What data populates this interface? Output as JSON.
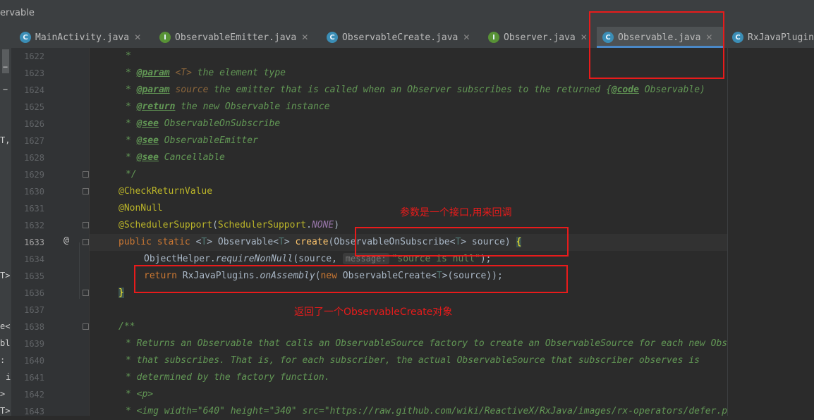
{
  "window": {
    "title": "ervable"
  },
  "tabs": [
    {
      "label": "MainActivity.java",
      "icon": "c",
      "active": false,
      "close": "✕"
    },
    {
      "label": "ObservableEmitter.java",
      "icon": "i",
      "active": false,
      "close": "✕"
    },
    {
      "label": "ObservableCreate.java",
      "icon": "c",
      "active": false,
      "close": "✕"
    },
    {
      "label": "Observer.java",
      "icon": "i",
      "active": false,
      "close": "✕"
    },
    {
      "label": "Observable.java",
      "icon": "c",
      "active": true,
      "close": "✕"
    },
    {
      "label": "RxJavaPlugins",
      "icon": "c",
      "active": false,
      "close": ""
    }
  ],
  "left_strip": {
    "fragments": [
      "T,",
      "T>",
      "e<",
      "bl",
      ":",
      "i",
      ">",
      "T>"
    ]
  },
  "gutter": {
    "line_numbers": [
      "1622",
      "1623",
      "1624",
      "1625",
      "1626",
      "1627",
      "1628",
      "1629",
      "1630",
      "1631",
      "1632",
      "1633",
      "1634",
      "1635",
      "1636",
      "1637",
      "1638",
      "1639",
      "1640",
      "1641",
      "1642",
      "1643"
    ],
    "current_line": "1633",
    "override_mark": "@"
  },
  "code": {
    "l1622": "*",
    "l1623": {
      "star": "* ",
      "tag": "@param",
      "param": "<T>",
      "rest": " the element type"
    },
    "l1624": {
      "star": "* ",
      "tag": "@param",
      "param": "source",
      "rest": " the emitter that is called when an Observer subscribes to the returned {",
      "code": "@code",
      "tail": " Observable)"
    },
    "l1625": {
      "star": "* ",
      "tag": "@return",
      "rest": " the new Observable instance"
    },
    "l1626": {
      "star": "* ",
      "tag": "@see",
      "rest": " ObservableOnSubscribe"
    },
    "l1627": {
      "star": "* ",
      "tag": "@see",
      "rest": " ObservableEmitter"
    },
    "l1628": {
      "star": "* ",
      "tag": "@see",
      "rest": " Cancellable"
    },
    "l1629": "*/",
    "l1630": "@CheckReturnValue",
    "l1631": "@NonNull",
    "l1632": {
      "ann": "@SchedulerSupport",
      "open": "(",
      "cls": "SchedulerSupport",
      "dot": ".",
      "field": "NONE",
      "close": ")"
    },
    "l1633": {
      "kw1": "public static ",
      "lt": "<",
      "T": "T",
      "gt": "> ",
      "ret": "Observable<",
      "T2": "T",
      "gt2": "> ",
      "name": "create",
      "p1": "(ObservableOnSubscribe<",
      "T3": "T",
      "p2": "> source) ",
      "brace": "{"
    },
    "l1634": {
      "pre": "ObjectHelper.",
      "method": "requireNonNull",
      "args": "(source, ",
      "hint": "message:",
      "str": "\"source is null\"",
      "end": ");"
    },
    "l1635": {
      "kw": "return ",
      "cls": "RxJavaPlugins.",
      "method": "onAssembly",
      "open": "(",
      "kw2": "new ",
      "ctor": "ObservableCreate<",
      "T": "T",
      "end": ">(source));"
    },
    "l1636": "}",
    "l1638": "/**",
    "l1639": "* Returns an Observable that calls an ObservableSource factory to create an ObservableSource for each new Obs",
    "l1640": "* that subscribes. That is, for each subscriber, the actual ObservableSource that subscriber observes is",
    "l1641": "* determined by the factory function.",
    "l1642": "* <p>",
    "l1643": "* <img width=\"640\" height=\"340\" src=\"https://raw.github.com/wiki/ReactiveX/RxJava/images/rx-operators/defer.p"
  },
  "annotations": {
    "note_param": "参数是一个接口,用来回调",
    "note_return": "返回了一个ObservableCreate对象"
  },
  "colors": {
    "annotation_red": "#e81b1b",
    "editor_bg": "#2b2b2b",
    "active_tab_underline": "#4a88c7"
  }
}
